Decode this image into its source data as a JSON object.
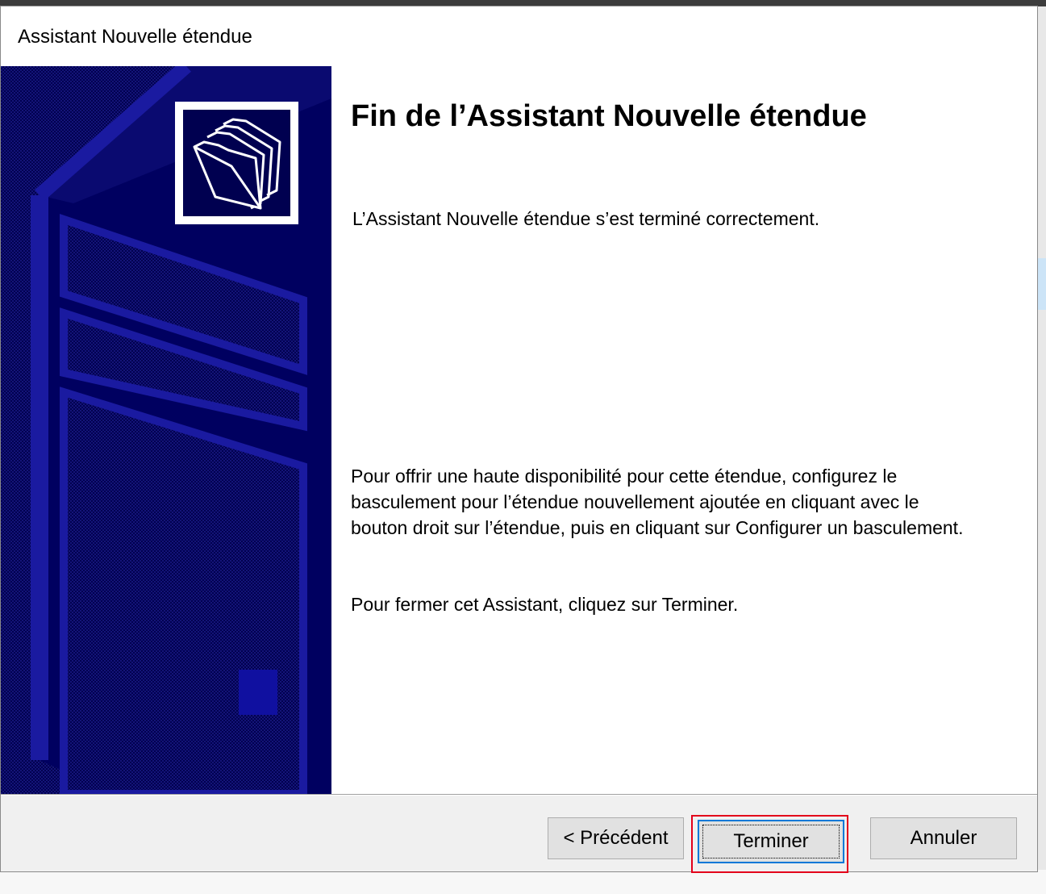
{
  "window": {
    "title": "Assistant Nouvelle étendue"
  },
  "wizard": {
    "heading": "Fin de l’Assistant Nouvelle étendue",
    "subtitle": "L’Assistant Nouvelle étendue s’est terminé correctement.",
    "paragraph_failover": "Pour offrir une haute disponibilité pour cette étendue, configurez le basculement pour l’étendue nouvellement ajoutée en cliquant avec le bouton droit sur l’étendue, puis en cliquant sur Configurer un basculement.",
    "paragraph_close": "Pour fermer cet Assistant, cliquez sur Terminer."
  },
  "buttons": {
    "previous": "< Précédent",
    "finish": "Terminer",
    "cancel": "Annuler"
  },
  "icons": {
    "sidebar_logo": "folders-icon"
  },
  "colors": {
    "sidebar_background": "#000060",
    "focus_border": "#0078d7",
    "highlight": "#e3001b"
  }
}
